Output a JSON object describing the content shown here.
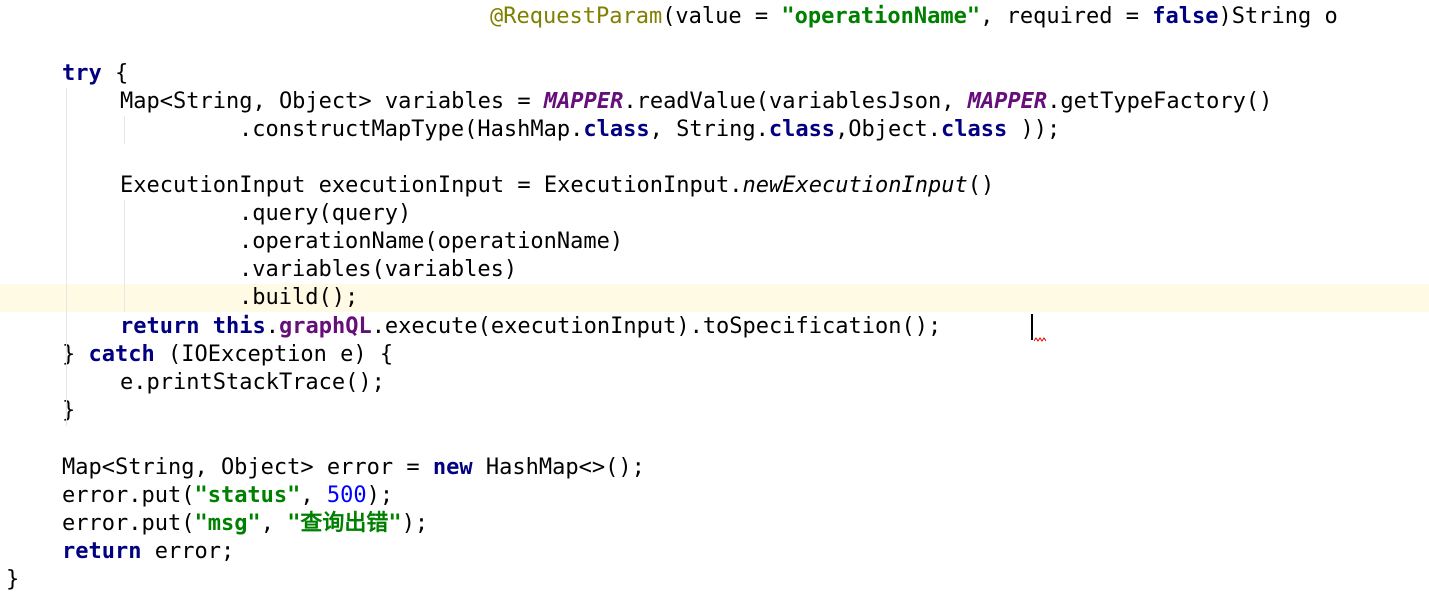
{
  "editor": {
    "language": "java",
    "current_line_index": 10,
    "colors": {
      "background": "#ffffff",
      "current_line": "#fffae3",
      "keyword": "#000080",
      "string": "#008000",
      "number": "#0000ff",
      "annotation": "#808000",
      "static_field": "#660e7a",
      "indent_guide": "#e6e6e6"
    },
    "lines": [
      {
        "tokens": [
          {
            "t": "@RequestParam",
            "c": "annot"
          },
          {
            "t": "(value = ",
            "c": "plain"
          },
          {
            "t": "\"operationName\"",
            "c": "string"
          },
          {
            "t": ", required = ",
            "c": "plain"
          },
          {
            "t": "false",
            "c": "keyword"
          },
          {
            "t": ")String o",
            "c": "plain"
          }
        ]
      },
      {
        "tokens": []
      },
      {
        "tokens": [
          {
            "t": "try",
            "c": "keyword"
          },
          {
            "t": " {",
            "c": "plain"
          }
        ]
      },
      {
        "tokens": [
          {
            "t": "Map<String, Object> variables = ",
            "c": "plain"
          },
          {
            "t": "MAPPER",
            "c": "static"
          },
          {
            "t": ".readValue(variablesJson, ",
            "c": "plain"
          },
          {
            "t": "MAPPER",
            "c": "static"
          },
          {
            "t": ".getTypeFactory()",
            "c": "plain"
          }
        ]
      },
      {
        "tokens": [
          {
            "t": ".constructMapType(HashMap.",
            "c": "plain"
          },
          {
            "t": "class",
            "c": "keyword"
          },
          {
            "t": ", String.",
            "c": "plain"
          },
          {
            "t": "class",
            "c": "keyword"
          },
          {
            "t": ",Object.",
            "c": "plain"
          },
          {
            "t": "class",
            "c": "keyword"
          },
          {
            "t": " ));",
            "c": "plain"
          }
        ]
      },
      {
        "tokens": []
      },
      {
        "tokens": [
          {
            "t": "ExecutionInput executionInput = ExecutionInput.",
            "c": "plain"
          },
          {
            "t": "newExecutionInput",
            "c": "italic"
          },
          {
            "t": "()",
            "c": "plain"
          }
        ]
      },
      {
        "tokens": [
          {
            "t": ".query(query)",
            "c": "plain"
          }
        ]
      },
      {
        "tokens": [
          {
            "t": ".operationName(operationName)",
            "c": "plain"
          }
        ]
      },
      {
        "tokens": [
          {
            "t": ".variables(variables)",
            "c": "plain"
          }
        ]
      },
      {
        "tokens": [
          {
            "t": ".build();",
            "c": "plain"
          }
        ]
      },
      {
        "tokens": [
          {
            "t": "return",
            "c": "keyword"
          },
          {
            "t": " ",
            "c": "plain"
          },
          {
            "t": "this",
            "c": "keyword"
          },
          {
            "t": ".",
            "c": "plain"
          },
          {
            "t": "graphQL",
            "c": "field"
          },
          {
            "t": ".execute(executionInput).toSpecification();",
            "c": "plain"
          }
        ]
      },
      {
        "tokens": [
          {
            "t": "} ",
            "c": "plain"
          },
          {
            "t": "catch",
            "c": "keyword"
          },
          {
            "t": " (IOException e) {",
            "c": "plain"
          }
        ]
      },
      {
        "tokens": [
          {
            "t": "e.printStackTrace();",
            "c": "plain"
          }
        ]
      },
      {
        "tokens": [
          {
            "t": "}",
            "c": "plain"
          }
        ]
      },
      {
        "tokens": []
      },
      {
        "tokens": [
          {
            "t": "Map<String, Object> error = ",
            "c": "plain"
          },
          {
            "t": "new",
            "c": "keyword"
          },
          {
            "t": " HashMap<>();",
            "c": "plain"
          }
        ]
      },
      {
        "tokens": [
          {
            "t": "error.put(",
            "c": "plain"
          },
          {
            "t": "\"status\"",
            "c": "string"
          },
          {
            "t": ", ",
            "c": "plain"
          },
          {
            "t": "500",
            "c": "number"
          },
          {
            "t": ");",
            "c": "plain"
          }
        ]
      },
      {
        "tokens": [
          {
            "t": "error.put(",
            "c": "plain"
          },
          {
            "t": "\"msg\"",
            "c": "string"
          },
          {
            "t": ", ",
            "c": "plain"
          },
          {
            "t": "\"查询出错\"",
            "c": "string"
          },
          {
            "t": ");",
            "c": "plain"
          }
        ]
      },
      {
        "tokens": [
          {
            "t": "return",
            "c": "keyword"
          },
          {
            "t": " error;",
            "c": "plain"
          }
        ]
      },
      {
        "tokens": [
          {
            "t": "}",
            "c": "plain"
          }
        ]
      }
    ]
  }
}
